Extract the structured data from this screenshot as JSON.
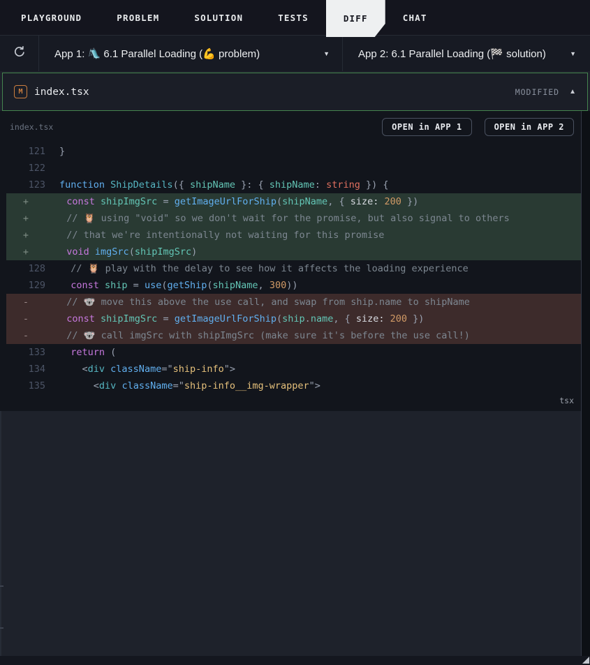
{
  "tabs": [
    {
      "label": "PLAYGROUND",
      "active": false
    },
    {
      "label": "PROBLEM",
      "active": false
    },
    {
      "label": "SOLUTION",
      "active": false
    },
    {
      "label": "TESTS",
      "active": false
    },
    {
      "label": "DIFF",
      "active": true
    },
    {
      "label": "CHAT",
      "active": false
    }
  ],
  "toolbar": {
    "app1_label": "App 1: 🛝 6.1 Parallel Loading (💪 problem)",
    "app2_label": "App 2: 6.1 Parallel Loading (🏁 solution)"
  },
  "icons": {
    "refresh": "⟳",
    "dropdown": "▼",
    "collapse": "▲"
  },
  "file_header": {
    "badge": "M",
    "filename": "index.tsx",
    "status": "MODIFIED"
  },
  "code_panel": {
    "file_label": "index.tsx",
    "open_app1": "OPEN in APP 1",
    "open_app2": "OPEN in APP 2",
    "language": "tsx",
    "lines": [
      {
        "num": "121",
        "type": "ctx",
        "tokens": [
          [
            "p",
            "}"
          ]
        ]
      },
      {
        "num": "122",
        "type": "ctx",
        "tokens": []
      },
      {
        "num": "123",
        "type": "ctx",
        "tokens": [
          [
            "b",
            "function "
          ],
          [
            "c2",
            "ShipDetails"
          ],
          [
            "p",
            "({ "
          ],
          [
            "t",
            "shipName"
          ],
          [
            "p",
            " }: { "
          ],
          [
            "t",
            "shipName"
          ],
          [
            "p",
            ": "
          ],
          [
            "ty",
            "string"
          ],
          [
            "p",
            " }) {"
          ]
        ]
      },
      {
        "sign": "+",
        "type": "add",
        "tokens": [
          [
            "k",
            "  const "
          ],
          [
            "t",
            "shipImgSrc"
          ],
          [
            "p",
            " = "
          ],
          [
            "b",
            "getImageUrlForShip"
          ],
          [
            "p",
            "("
          ],
          [
            "t",
            "shipName"
          ],
          [
            "p",
            ", { "
          ],
          [
            "w",
            "size: "
          ],
          [
            "n",
            "200"
          ],
          [
            "p",
            " })"
          ]
        ]
      },
      {
        "sign": "+",
        "type": "add",
        "tokens": [
          [
            "cm",
            "  // 🦉 using \"void\" so we don't wait for the promise, but also signal to others"
          ]
        ]
      },
      {
        "sign": "+",
        "type": "add",
        "tokens": [
          [
            "cm",
            "  // that we're intentionally not waiting for this promise"
          ]
        ]
      },
      {
        "sign": "+",
        "type": "add",
        "tokens": [
          [
            "k",
            "  void"
          ],
          [
            "p",
            " "
          ],
          [
            "b",
            "imgSrc"
          ],
          [
            "p",
            "("
          ],
          [
            "t",
            "shipImgSrc"
          ],
          [
            "p",
            ")"
          ]
        ]
      },
      {
        "num": "128",
        "type": "ctx",
        "tokens": [
          [
            "cm",
            "  // 🦉 play with the delay to see how it affects the loading experience"
          ]
        ]
      },
      {
        "num": "129",
        "type": "ctx",
        "tokens": [
          [
            "k",
            "  const "
          ],
          [
            "t",
            "ship"
          ],
          [
            "p",
            " = "
          ],
          [
            "b",
            "use"
          ],
          [
            "p",
            "("
          ],
          [
            "b",
            "getShip"
          ],
          [
            "p",
            "("
          ],
          [
            "t",
            "shipName"
          ],
          [
            "p",
            ", "
          ],
          [
            "n",
            "300"
          ],
          [
            "p",
            "))"
          ]
        ]
      },
      {
        "sign": "-",
        "type": "del",
        "tokens": [
          [
            "cm",
            "  // 🐨 move this above the use call, and swap from ship.name to shipName"
          ]
        ]
      },
      {
        "sign": "-",
        "type": "del",
        "tokens": [
          [
            "k",
            "  const "
          ],
          [
            "t",
            "shipImgSrc"
          ],
          [
            "p",
            " = "
          ],
          [
            "b",
            "getImageUrlForShip"
          ],
          [
            "p",
            "("
          ],
          [
            "t",
            "ship"
          ],
          [
            "p",
            "."
          ],
          [
            "t",
            "name"
          ],
          [
            "p",
            ", { "
          ],
          [
            "w",
            "size: "
          ],
          [
            "n",
            "200"
          ],
          [
            "p",
            " })"
          ]
        ]
      },
      {
        "sign": "-",
        "type": "del",
        "tokens": [
          [
            "cm",
            "  // 🐨 call imgSrc with shipImgSrc (make sure it's before the use call!)"
          ]
        ]
      },
      {
        "num": "133",
        "type": "ctx",
        "tokens": [
          [
            "k",
            "  return"
          ],
          [
            "p",
            " ("
          ]
        ]
      },
      {
        "num": "134",
        "type": "ctx",
        "tokens": [
          [
            "p",
            "    <"
          ],
          [
            "c2",
            "div"
          ],
          [
            "p",
            " "
          ],
          [
            "b",
            "className"
          ],
          [
            "p",
            "=\""
          ],
          [
            "s",
            "ship-info"
          ],
          [
            "p",
            "\">"
          ]
        ]
      },
      {
        "num": "135",
        "type": "ctx",
        "tokens": [
          [
            "p",
            "      <"
          ],
          [
            "c2",
            "div"
          ],
          [
            "p",
            " "
          ],
          [
            "b",
            "className"
          ],
          [
            "p",
            "=\""
          ],
          [
            "s",
            "ship-info__img-wrapper"
          ],
          [
            "p",
            "\">"
          ]
        ]
      }
    ]
  },
  "colors": {
    "accent_green_border": "#45854f",
    "added_line_bg": "#293a33",
    "removed_line_bg": "#3d2b2b",
    "badge_orange": "#cd7f3f",
    "active_tab_bg": "#eef0f1",
    "code_bg": "#12151c",
    "panel_bg": "#1e222b",
    "bar_bg": "#14151e"
  }
}
